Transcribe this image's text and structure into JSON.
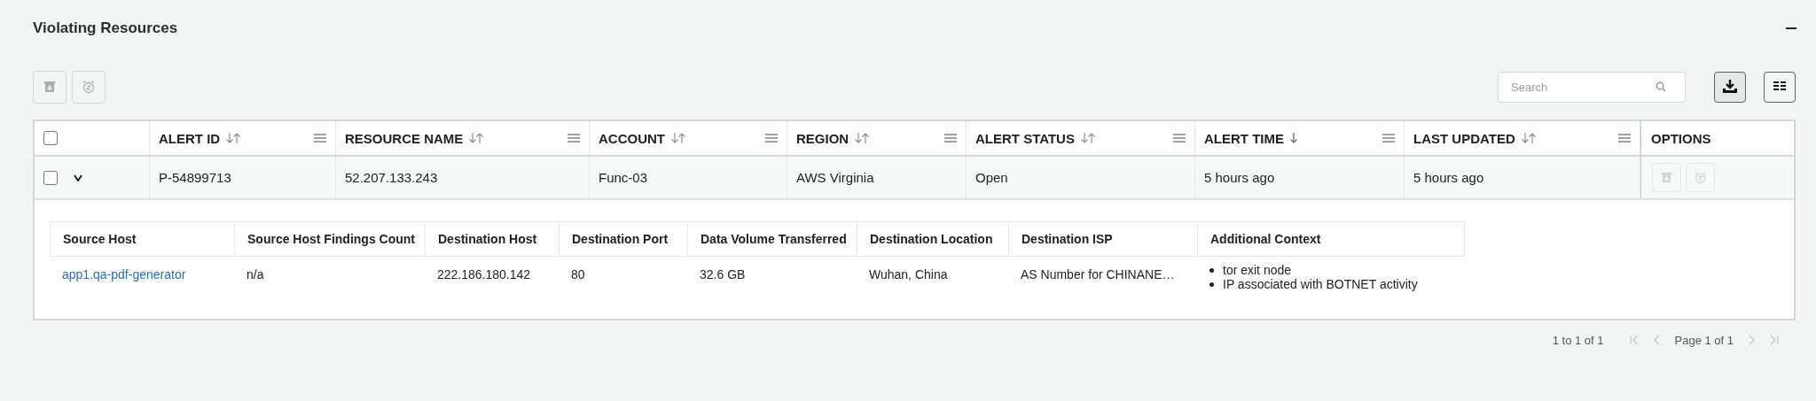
{
  "panel": {
    "title": "Violating Resources",
    "collapsed": false
  },
  "toolbar": {
    "actions": [
      {
        "kind": "archive",
        "disabled": true
      },
      {
        "kind": "snooze",
        "disabled": true
      }
    ],
    "search": {
      "placeholder": "Search"
    }
  },
  "table": {
    "columns": [
      {
        "label": "ALERT ID",
        "sorted": false
      },
      {
        "label": "RESOURCE NAME",
        "sorted": false
      },
      {
        "label": "ACCOUNT",
        "sorted": false
      },
      {
        "label": "REGION",
        "sorted": false
      },
      {
        "label": "ALERT STATUS",
        "sorted": false
      },
      {
        "label": "ALERT TIME",
        "sorted": true
      },
      {
        "label": "LAST UPDATED",
        "sorted": false
      }
    ],
    "options_header": "OPTIONS",
    "header_checked": false,
    "rows": [
      {
        "checked": false,
        "expanded": true,
        "cells": [
          "P-54899713",
          "52.207.133.243",
          "Func-03",
          "AWS Virginia",
          "Open",
          "5 hours ago",
          "5 hours ago"
        ],
        "options": [
          {
            "kind": "archive",
            "disabled": true
          },
          {
            "kind": "snooze",
            "disabled": true
          }
        ],
        "detail": {
          "columns": [
            "Source Host",
            "Source Host Findings Count",
            "Destination Host",
            "Destination Port",
            "Data Volume Transferred",
            "Destination Location",
            "Destination ISP",
            "Additional Context"
          ],
          "rows": [
            {
              "cells": [
                {
                  "kind": "link",
                  "text": "app1.qa-pdf-generator"
                },
                {
                  "kind": "text",
                  "text": "n/a"
                },
                {
                  "kind": "text",
                  "text": "222.186.180.142"
                },
                {
                  "kind": "text",
                  "text": "80"
                },
                {
                  "kind": "text",
                  "text": "32.6 GB"
                },
                {
                  "kind": "text",
                  "text": "Wuhan, China"
                },
                {
                  "kind": "text",
                  "text": "AS Number for CHINANE…"
                },
                {
                  "kind": "list",
                  "items": [
                    "tor exit node",
                    "IP associated with BOTNET activity"
                  ]
                }
              ]
            }
          ]
        }
      }
    ]
  },
  "pagination": {
    "range": "1 to 1 of 1",
    "page": "Page 1 of 1",
    "first_disabled": true,
    "prev_disabled": true,
    "next_disabled": true,
    "last_disabled": true
  }
}
